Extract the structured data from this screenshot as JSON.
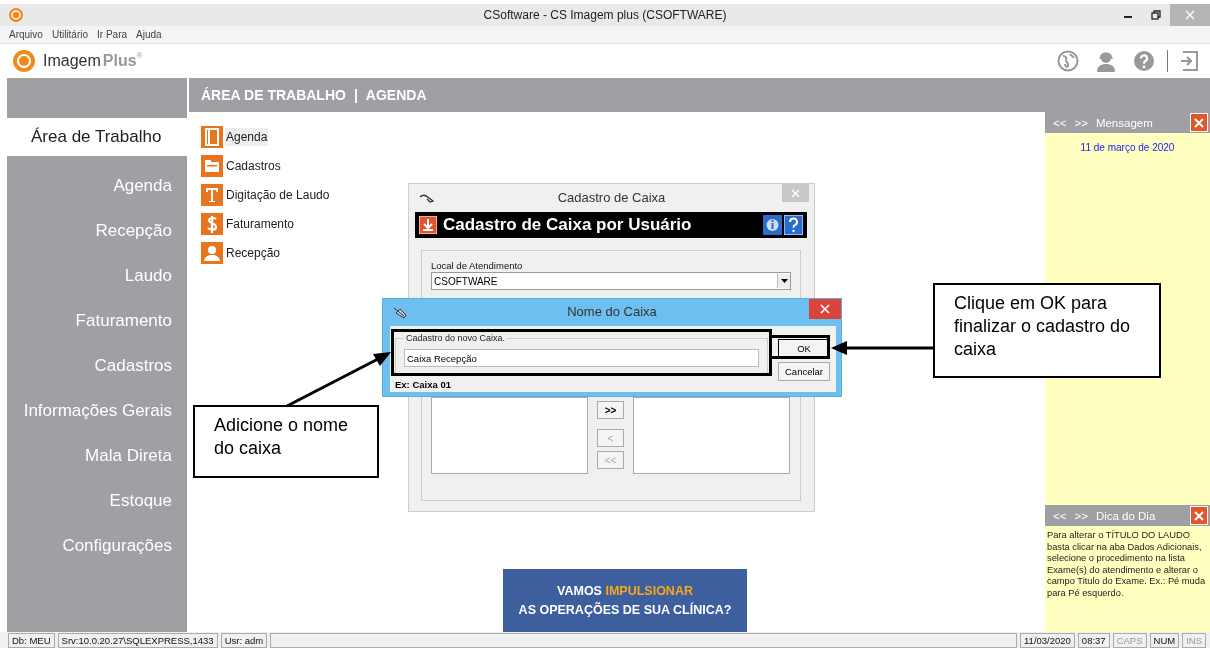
{
  "window": {
    "title": "CSoftware - CS Imagem plus (CSOFTWARE)"
  },
  "menu": [
    "Arquivo",
    "Utilitário",
    "Ir Para",
    "Ajuda"
  ],
  "logo": {
    "name": "Imagem",
    "suffix": "Plus",
    "mark": "®"
  },
  "toolbar": [
    {
      "kind": "globe"
    },
    {
      "kind": "support"
    },
    {
      "kind": "help"
    },
    {
      "kind": "exit"
    }
  ],
  "breadcrumb": [
    "ÁREA DE TRABALHO",
    "|",
    "AGENDA"
  ],
  "sidebar": {
    "items": [
      {
        "label": "Área de Trabalho",
        "selected": true
      },
      {
        "label": "Agenda",
        "selected": false
      },
      {
        "label": "Recepção",
        "selected": false
      },
      {
        "label": "Laudo",
        "selected": false
      },
      {
        "label": "Faturamento",
        "selected": false
      },
      {
        "label": "Cadastros",
        "selected": false
      },
      {
        "label": "Informações Gerais",
        "selected": false
      },
      {
        "label": "Mala Direta",
        "selected": false
      },
      {
        "label": "Estoque",
        "selected": false
      },
      {
        "label": "Configurações",
        "selected": false
      }
    ]
  },
  "shortcuts": [
    {
      "kind": "book",
      "label": "Agenda",
      "selected": true
    },
    {
      "kind": "folder",
      "label": "Cadastros",
      "selected": false
    },
    {
      "kind": "letter",
      "label": "Digitação de Laudo",
      "selected": false
    },
    {
      "kind": "dollar",
      "label": "Faturamento",
      "selected": false
    },
    {
      "kind": "person",
      "label": "Recepção",
      "selected": false
    }
  ],
  "message_panel": {
    "prev": "<<",
    "next": ">>",
    "title": "Mensagem",
    "date": "11 de março de 2020"
  },
  "tip_panel": {
    "prev": "<<",
    "next": ">>",
    "title": "Dica do Dia",
    "text": "Para alterar o TÍTULO DO LAUDO basta clicar na aba Dados Adicionais, selecione o procedimento na lista Exame(s) do atendimento e alterar o campo Titulo do Exame. Ex.: Pé muda para Pé esquerdo."
  },
  "cadastro_dialog": {
    "title": "Cadastro de Caixa",
    "header": "Cadastro de Caixa por Usuário",
    "field_label": "Local de Atendimento",
    "field_value": "CSOFTWARE",
    "move_buttons": [
      {
        "label": ">>",
        "disabled": false
      },
      {
        "label": "<",
        "disabled": true
      },
      {
        "label": "<<",
        "disabled": true
      }
    ]
  },
  "name_dialog": {
    "title": "Nome do Caixa",
    "group_label": "Cadastro do novo Caixa.",
    "value": "Caixa Recepção",
    "hint": "Ex: Caixa 01",
    "buttons": [
      "OK",
      "Cancelar"
    ]
  },
  "annotations": [
    {
      "kind": "ok",
      "text": "Clique em OK para finalizar o cadastro do caixa"
    },
    {
      "kind": "field",
      "text": "Adicione o nome do caixa"
    }
  ],
  "banner": {
    "lead": "VAMOS ",
    "highlight": "IMPULSIONAR",
    "line2": "AS OPERAÇÕES DE SUA CLÍNICA?"
  },
  "status_bar": {
    "left": [
      "Db: MEU",
      "Srv:10.0.20.27\\SQLEXPRESS,1433",
      "Usr: adm"
    ],
    "right": [
      {
        "label": "11/03/2020",
        "on": true
      },
      {
        "label": "08:37",
        "on": true
      },
      {
        "label": "CAPS",
        "on": false
      },
      {
        "label": "NUM",
        "on": true
      },
      {
        "label": "INS",
        "on": false
      }
    ]
  }
}
